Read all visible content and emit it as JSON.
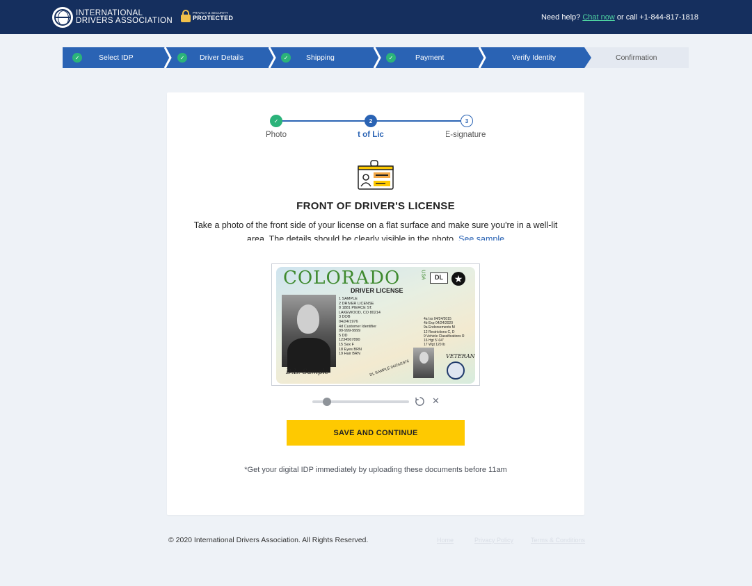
{
  "header": {
    "logo_line1": "INTERNATIONAL",
    "logo_line2": "DRIVERS ASSOCIATION",
    "badge_small": "PRIVACY & SECURITY",
    "badge_big": "PROTECTED",
    "help_text": "Need help?",
    "chat_link": "Chat now",
    "call_text": "or call +1-844-817-1818"
  },
  "steps": [
    {
      "label": "Select IDP",
      "done": true
    },
    {
      "label": "Driver Details",
      "done": true
    },
    {
      "label": "Shipping",
      "done": true
    },
    {
      "label": "Payment",
      "done": true
    },
    {
      "label": "Verify Identity",
      "done": false,
      "active": true
    },
    {
      "label": "Confirmation",
      "done": false
    }
  ],
  "substeps": {
    "step1_label": "Photo",
    "step1_icon": "✓",
    "step2_number": "2",
    "step2_label": "t of Lic",
    "step3_number": "3",
    "step3_label": "E-signature"
  },
  "main": {
    "title": "FRONT OF DRIVER'S LICENSE",
    "description": "Take a photo of the front side of your license on a flat surface and make sure you're in a well-lit area. The details should be clearly visible in the photo.",
    "sample_link": "See sample",
    "save_button": "SAVE AND CONTINUE",
    "note": "*Get your digital IDP immediately by uploading these documents before 11am"
  },
  "license": {
    "state": "COLORADO",
    "usa": "USA",
    "class": "DL",
    "type": "DRIVER LICENSE",
    "lines": [
      "1 SAMPLE",
      "2 DRIVER LICENSE",
      "8 1881 PIERCE ST.",
      "LAKEWOOD, CO 80214",
      "3 DOB",
      "04/24/1976",
      "4d Customer Identifier",
      "99-999-9999",
      "5 DD",
      "1234567890",
      "15 Sex  F",
      "18 Eyes  BRN",
      "19 Hair  BRN"
    ],
    "lines2": [
      "4a Iss  04/24/2015",
      "4b Exp  04/24/2020",
      "9a Endorsements  M",
      "12 Restrictions  C, D",
      "9 Vehicle Classifications  R",
      "16 Hgt  5'-04\"",
      "17 Wgt  120 lb"
    ],
    "signature": "D.L. Sample",
    "dob_vertical": "DL SAMPLE 04/24/1976",
    "veteran": "VETERAN"
  },
  "footer": {
    "copyright": "© 2020 International Drivers Association. All Rights Reserved.",
    "home": "Home",
    "privacy": "Privacy Policy",
    "terms": "Terms & Conditions"
  },
  "colors": {
    "header_bg": "#152f5e",
    "primary": "#2a63b4",
    "success": "#2bb37a",
    "cta": "#fec901",
    "chat_link": "#4ed2a1"
  },
  "zoom_level": 0.15
}
